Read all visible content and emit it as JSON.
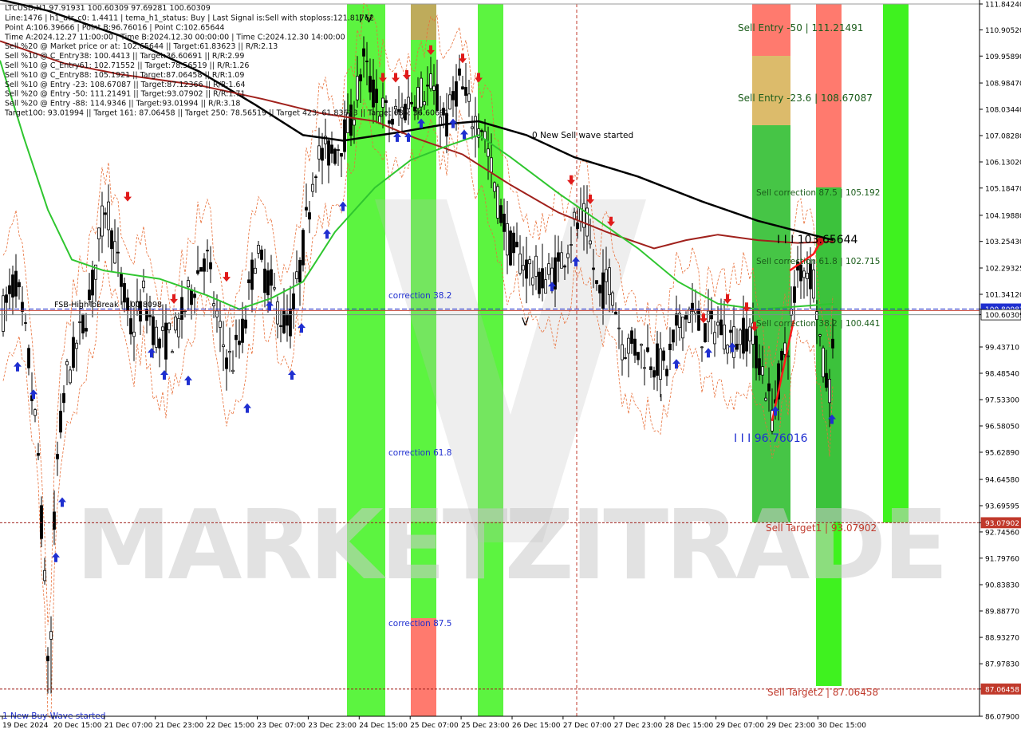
{
  "chart_data": {
    "type": "candlestick",
    "symbol_header": "LTCUSD,H1  97.91931 100.60309 97.69281 100.60309",
    "info_lines": [
      "Line:1476 | h1_atr_c0: 1.4411 | tema_h1_status: Buy | Last Signal is:Sell with stoploss:121.81762",
      "Point A:106.39666 | Point B:96.76016 | Point C:102.65644",
      "Time A:2024.12.27 11:00:00 | Time B:2024.12.30 00:00:00 | Time C:2024.12.30 14:00:00",
      "Sell %20 @ Market price or at: 102.65644 || Target:61.83623 || R/R:2.13",
      "Sell %10 @ C_Entry38: 100.4413 || Target:36.60691 || R/R:2.99",
      "Sell %10 @ C_Entry61: 102.71552 || Target:78.56519 || R/R:1.26",
      "Sell %10 @ C_Entry88: 105.1921 || Target:87.06458 || R/R:1.09",
      "Sell %10 @ Entry -23: 108.67087 || Target:87.12366 || R/R:1.64",
      "Sell %20 @ Entry -50: 111.21491 || Target:93.07902 || R/R:1.71",
      "Sell %20 @ Entry -88: 114.9346 || Target:93.01994 || R/R:3.18",
      "Target100: 93.01994 || Target 161: 87.06458 || Target 250: 78.56519 || Target 423: 61.83623 || Target 685: 36.60691"
    ],
    "price_axis_ticks": [
      "111.84240",
      "110.90520",
      "109.95890",
      "108.98470",
      "108.03440",
      "107.08280",
      "106.13020",
      "105.18470",
      "104.19880",
      "103.25430",
      "102.29325",
      "101.34120",
      "100.80983",
      "100.60309",
      "99.43710",
      "98.48540",
      "97.53300",
      "96.58050",
      "95.62890",
      "94.64580",
      "93.69595",
      "93.07902",
      "92.74560",
      "91.79760",
      "90.83830",
      "89.88770",
      "88.93270",
      "87.97830",
      "87.06458",
      "86.07900"
    ],
    "time_axis_labels": [
      "19 Dec 2024",
      "20 Dec 15:00",
      "21 Dec 07:00",
      "21 Dec 23:00",
      "22 Dec 15:00",
      "23 Dec 07:00",
      "23 Dec 23:00",
      "24 Dec 15:00",
      "25 Dec 07:00",
      "25 Dec 23:00",
      "26 Dec 15:00",
      "27 Dec 07:00",
      "27 Dec 23:00",
      "28 Dec 15:00",
      "29 Dec 07:00",
      "29 Dec 23:00",
      "30 Dec 15:00"
    ],
    "ylim": [
      86.079,
      111.8424
    ],
    "levels": {
      "current_price": 100.60309,
      "ask_line": 100.80983,
      "sell_target_1": 93.07902,
      "sell_target_2": 87.06458
    },
    "highlighted_labels": [
      {
        "text": "100.80983",
        "value": 100.80983,
        "bg": "#1f2fd0"
      },
      {
        "text": "100.60309",
        "value": 100.60309,
        "bg": "#ffffff"
      },
      {
        "text": "93.07902",
        "value": 93.07902,
        "bg": "#c0392b"
      },
      {
        "text": "87.06458",
        "value": 87.06458,
        "bg": "#c0392b"
      }
    ],
    "annotations": [
      {
        "text": "Sell Entry -50 | 111.21491",
        "value": 111.21491,
        "color": "#1a5c1a"
      },
      {
        "text": "Sell Entry -23.6 | 108.67087",
        "value": 108.67087,
        "color": "#1a5c1a"
      },
      {
        "text": "Sell correction 87.5 | 105.192",
        "value": 105.192,
        "color": "#1a5c1a"
      },
      {
        "text": "Sell correction 61.8 | 102.715",
        "value": 102.715,
        "color": "#1a5c1a"
      },
      {
        "text": "Sell correction 38.2 | 100.441",
        "value": 100.441,
        "color": "#1a5c1a"
      },
      {
        "text": "I I I 103.65644",
        "value": 103.65644,
        "color": "#000000"
      },
      {
        "text": "I I I 96.76016",
        "value": 96.76016,
        "color": "#1f2fd0"
      },
      {
        "text": "0 New Sell wave started",
        "value": 107.08,
        "color": "#000000"
      },
      {
        "text": "correction 38.2",
        "value": 101.2,
        "color": "#1f2fd0"
      },
      {
        "text": "correction 61.8",
        "value": 95.6,
        "color": "#1f2fd0"
      },
      {
        "text": "correction 87.5",
        "value": 89.5,
        "color": "#1f2fd0"
      },
      {
        "text": "FSB-HighToBreak | 100.8098",
        "value": 100.95,
        "color": "#000000"
      },
      {
        "text": "Sell Target1 | 93.07902",
        "value": 92.8,
        "color": "#c0392b"
      },
      {
        "text": "Sell Target2 | 87.06458",
        "value": 86.8,
        "color": "#c0392b"
      },
      {
        "text": "1 New Buy Wave started",
        "value": 86.2,
        "color": "#1f2fd0"
      },
      {
        "text": "I V",
        "value": 111.3,
        "color": "#000000"
      },
      {
        "text": "V",
        "value": 100.2,
        "color": "#000000"
      }
    ],
    "watermark": "MARKETZITRADE",
    "colors": {
      "bull": "#000000",
      "bear": "#000000",
      "ma_black": "#000000",
      "ma_darkred": "#a0211c",
      "ma_green": "#2fc62f",
      "zone_green": "#3ff21f",
      "zone_red": "#ff7a6e"
    }
  }
}
